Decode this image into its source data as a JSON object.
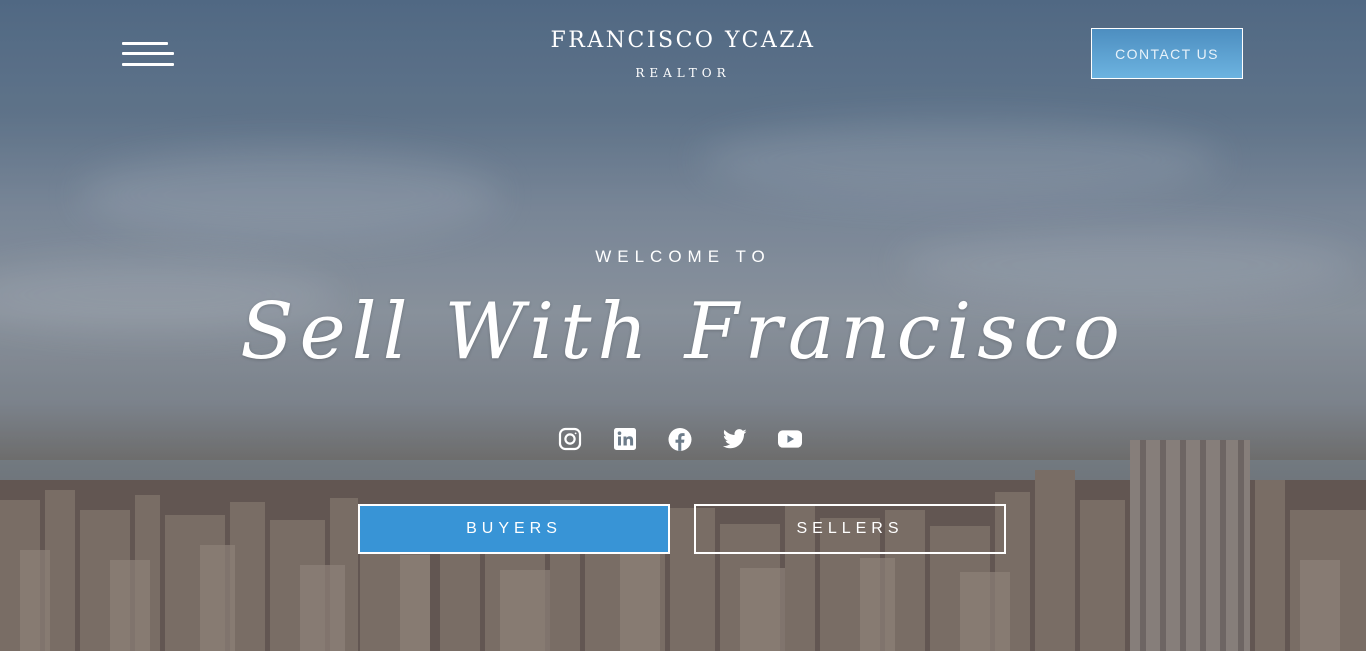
{
  "header": {
    "brand_name": "FRANCISCO YCAZA",
    "brand_subtitle": "REALTOR",
    "contact_label": "CONTACT US"
  },
  "hero": {
    "welcome": "WELCOME TO",
    "headline": "Sell With Francisco"
  },
  "social": [
    {
      "icon": "instagram-icon"
    },
    {
      "icon": "linkedin-icon"
    },
    {
      "icon": "facebook-icon"
    },
    {
      "icon": "twitter-icon"
    },
    {
      "icon": "youtube-icon"
    }
  ],
  "buttons": {
    "buyers": "BUYERS",
    "sellers": "SELLERS"
  },
  "colors": {
    "accent": "#3894d6",
    "contact_button": "#5ea6d6",
    "text": "#ffffff"
  }
}
